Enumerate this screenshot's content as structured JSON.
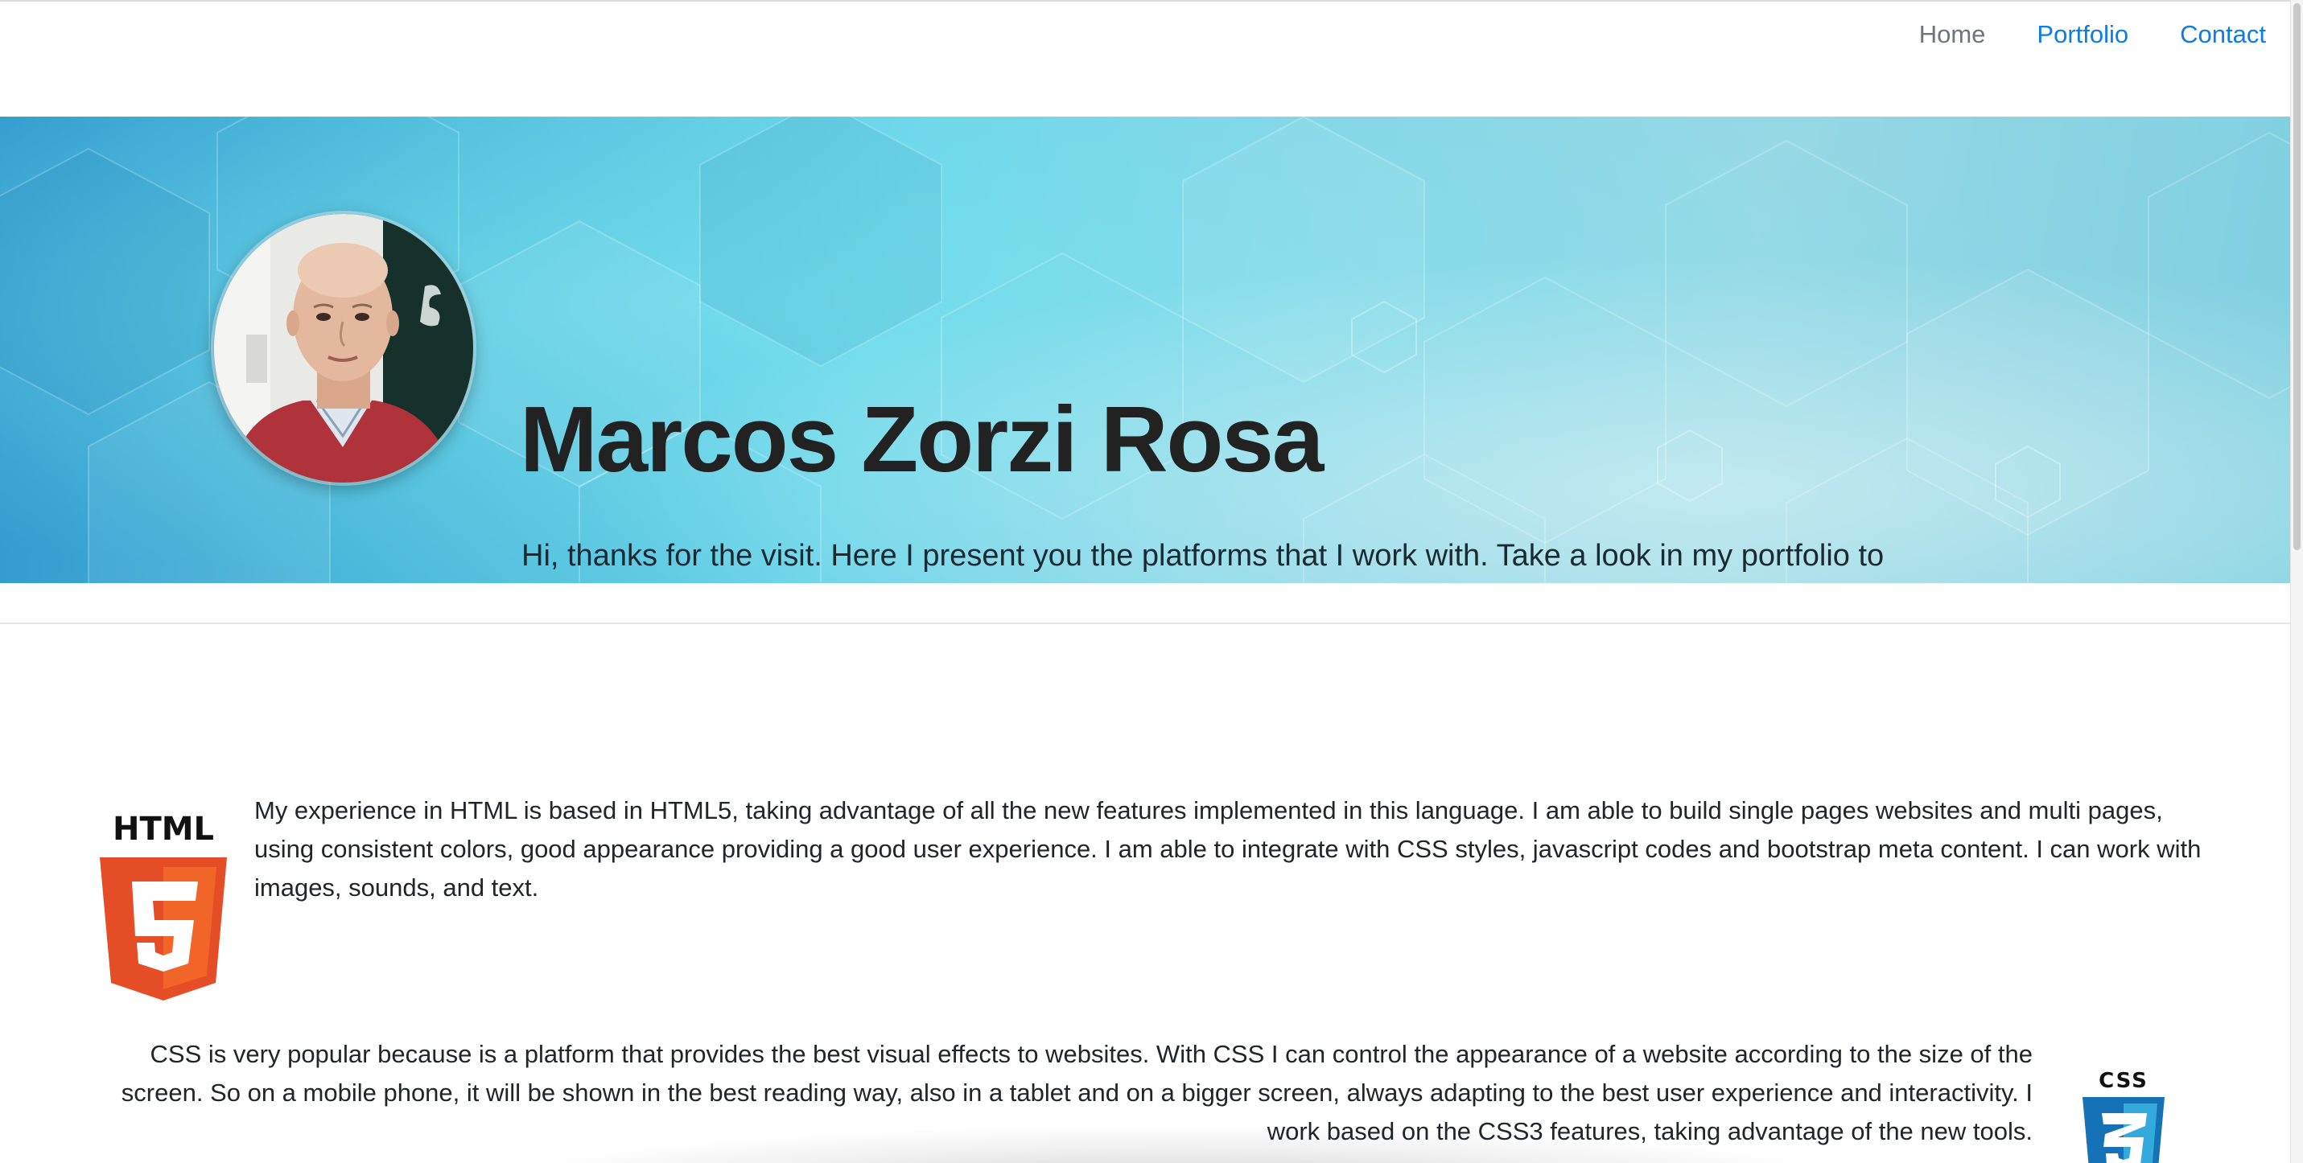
{
  "navbar": {
    "links": [
      {
        "label": "Home"
      },
      {
        "label": "Portfolio"
      },
      {
        "label": "Contact"
      }
    ]
  },
  "hero": {
    "name": "Marcos Zorzi Rosa",
    "lead": "Hi, thanks for the visit. Here I present you the platforms that I work with. Take a look in my portfolio to see my creations.",
    "avatar_icon": "profile-photo"
  },
  "skills": {
    "html": {
      "logo_text": "HTML",
      "logo_number": "5",
      "text": "My experience in HTML is based in HTML5, taking advantage of all the new features implemented in this language. I am able to build single pages websites and multi pages, using consistent colors, good appearance providing a good user experience. I am able to integrate with CSS styles, javascript codes and bootstrap meta content. I can work with images, sounds, and text."
    },
    "css": {
      "logo_text": "CSS",
      "logo_number": "3",
      "text": "CSS is very popular because is a platform that provides the best visual effects to websites. With CSS I can control the appearance of a website according to the size of the screen. So on a mobile phone, it will be shown in the best reading way, also in a tablet and on a bigger screen, always adapting to the best user experience and interactivity. I work based on the CSS3 features, taking advantage of the new tools."
    }
  },
  "colors": {
    "link": "#0d7be8",
    "link_muted": "#6c757d",
    "html5_orange": "#e44d26",
    "css3_blue": "#1572b6"
  }
}
